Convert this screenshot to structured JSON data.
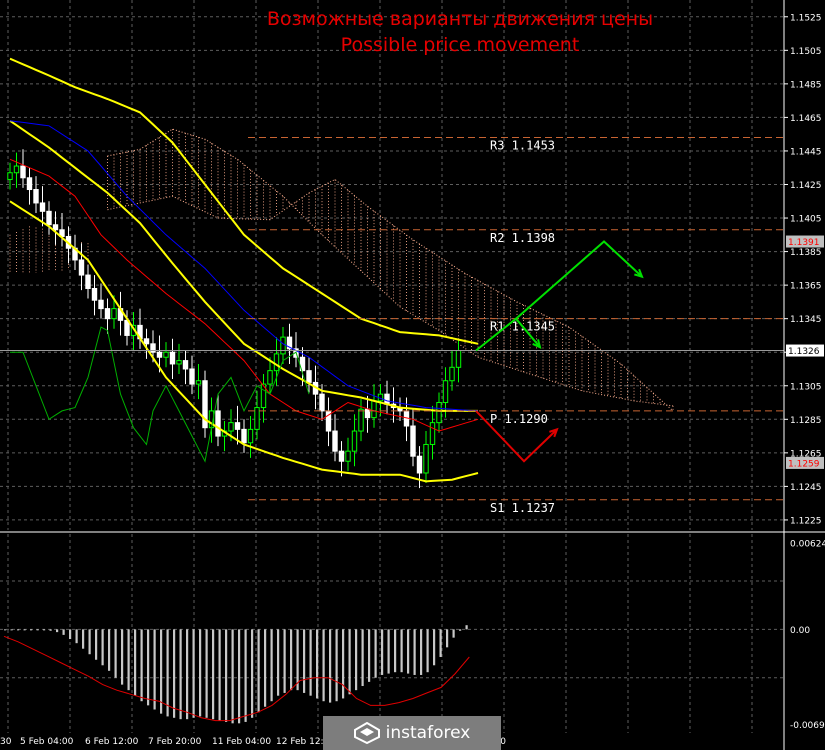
{
  "title_ru": "Возможные варианты движения цены",
  "title_en": "Possible price movement",
  "brand": "instaforex",
  "colors": {
    "background": "#000000",
    "grid": "#5e5e5e",
    "candle_up": "#00ff00",
    "candle_down": "#ffffff",
    "bollinger": "#ffff00",
    "tenkan": "#ff0000",
    "kijun": "#0000ff",
    "chikou": "#00b000",
    "cloud": "#ffb090",
    "level_line": "#c86432",
    "level_label": "#ffffff",
    "macd_hist": "#c8c8c8",
    "macd_signal": "#e00000",
    "arrow_up": "#00e000",
    "arrow_down": "#e00000",
    "title": "#e60000"
  },
  "chart_data": [
    {
      "type": "candlestick",
      "title": "Возможные варианты движения цены / Possible price movement",
      "ylim": [
        1.1219,
        1.1535
      ],
      "y_ticks": [
        "1.1525",
        "1.1505",
        "1.1485",
        "1.1465",
        "1.1445",
        "1.1425",
        "1.1405",
        "1.1385",
        "1.1365",
        "1.1345",
        "1.1325",
        "1.1305",
        "1.1285",
        "1.1265",
        "1.1245",
        "1.1225"
      ],
      "x_ticks": [
        "30",
        "5 Feb 04:00",
        "6 Feb 12:00",
        "7 Feb 20:00",
        "11 Feb 04:00",
        "12 Feb 12:00",
        "12:00"
      ],
      "levels": [
        {
          "name": "R3",
          "label": "R3 1.1453",
          "value": 1.1453
        },
        {
          "name": "R2",
          "label": "R2 1.1398",
          "value": 1.1398
        },
        {
          "name": "R1",
          "label": "R1 1.1345",
          "value": 1.1345
        },
        {
          "name": "P",
          "label": "P 1.1290",
          "value": 1.129
        },
        {
          "name": "S1",
          "label": "S1 1.1237",
          "value": 1.1237
        }
      ],
      "price_tags": [
        {
          "value": 1.1391,
          "label": "1.1391",
          "bg": "#c0c0c0",
          "fg": "#ff0000"
        },
        {
          "value": 1.1326,
          "label": "1.1326",
          "bg": "#ffffff",
          "fg": "#000000"
        },
        {
          "value": 1.1259,
          "label": "1.1259",
          "bg": "#c0c0c0",
          "fg": "#ff0000"
        }
      ],
      "current_price": 1.1326,
      "gridlines": true
    },
    {
      "type": "bar",
      "name": "MACD",
      "ylim": [
        -0.0075,
        0.0069
      ],
      "y_ticks": [
        "0.00624",
        "0.00",
        "-0.0069"
      ],
      "hist_values": [
        0.0,
        0.0,
        0.0,
        0.0,
        0.0,
        0.0,
        0.0,
        -0.0001,
        -0.0002,
        -0.0004,
        -0.0007,
        -0.001,
        -0.0014,
        -0.0018,
        -0.0022,
        -0.0026,
        -0.003,
        -0.0035,
        -0.004,
        -0.0044,
        -0.0048,
        -0.0052,
        -0.0055,
        -0.0058,
        -0.0061,
        -0.0063,
        -0.0064,
        -0.0065,
        -0.0065,
        -0.0064,
        -0.0063,
        -0.0064,
        -0.0065,
        -0.0066,
        -0.0067,
        -0.0068,
        -0.0068,
        -0.0067,
        -0.0064,
        -0.006,
        -0.0056,
        -0.0052,
        -0.0048,
        -0.0046,
        -0.0044,
        -0.0044,
        -0.0046,
        -0.0048,
        -0.005,
        -0.0052,
        -0.0053,
        -0.0052,
        -0.005,
        -0.0047,
        -0.0044,
        -0.0041,
        -0.0038,
        -0.0035,
        -0.0033,
        -0.0032,
        -0.0031,
        -0.0031,
        -0.0032,
        -0.0033,
        -0.0033,
        -0.0031,
        -0.0026,
        -0.002,
        -0.0013,
        -0.0006,
        -0.0001,
        0.0003
      ],
      "signal_values": [
        -0.0005,
        -0.0009,
        -0.0014,
        -0.0019,
        -0.0024,
        -0.0029,
        -0.0034,
        -0.004,
        -0.0044,
        -0.0047,
        -0.005,
        -0.0052,
        -0.0057,
        -0.006,
        -0.0064,
        -0.0066,
        -0.0066,
        -0.0063,
        -0.006,
        -0.0055,
        -0.0047,
        -0.0037,
        -0.0035,
        -0.0035,
        -0.004,
        -0.005,
        -0.0055,
        -0.0055,
        -0.0053,
        -0.005,
        -0.0046,
        -0.0042,
        -0.0032,
        -0.002
      ],
      "gridlines": true
    }
  ]
}
